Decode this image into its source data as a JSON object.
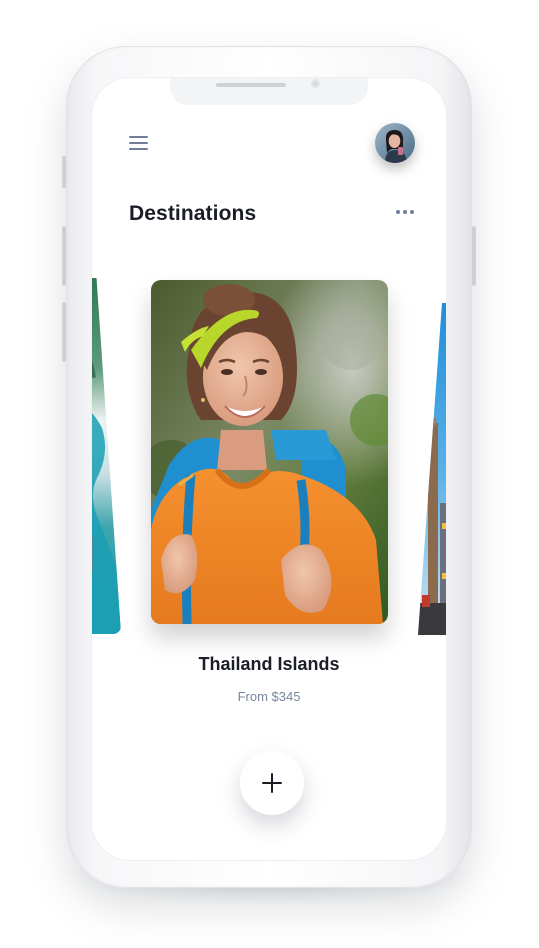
{
  "header": {
    "menu_icon": "hamburger-menu-icon",
    "avatar_icon": "user-avatar"
  },
  "page": {
    "title": "Destinations",
    "more_icon": "more-horizontal-icon"
  },
  "carousel": {
    "featured": {
      "name": "Thailand Islands",
      "price": "From $345"
    }
  },
  "actions": {
    "add_icon": "plus-icon"
  },
  "colors": {
    "title": "#1b1e27",
    "muted": "#7986a0",
    "icon": "#6f7f97",
    "orange_sweater": "#f08a2c",
    "backpack_blue": "#1f8fd0",
    "headband_green": "#b9d62a"
  }
}
